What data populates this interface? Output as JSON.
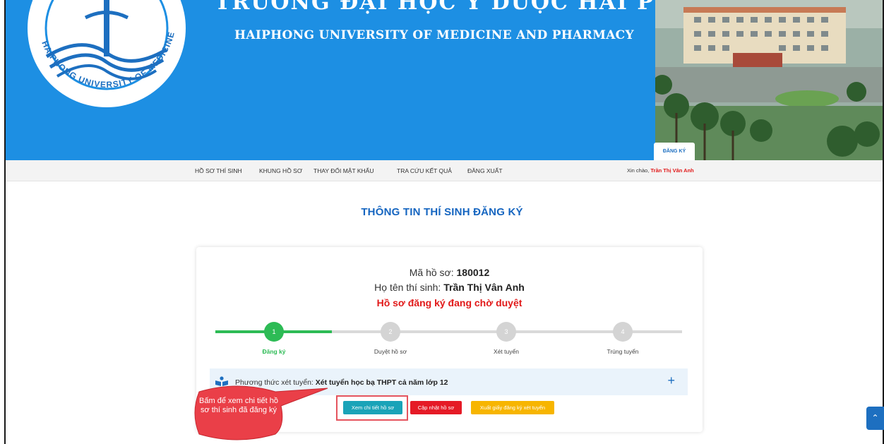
{
  "header": {
    "title_vn": "TRƯỜNG ĐẠI HỌC Y DƯỢC HẢI PHÒNG",
    "title_en": "HAIPHONG UNIVERSITY OF MEDICINE AND PHARMACY",
    "logo_text": "HAIPHONG UNIVERSITY OF MEDICINE AND PHARMACY",
    "register_tab": "ĐĂNG KÝ",
    "brand_color": "#1d8fe3"
  },
  "nav": {
    "items": [
      "HỒ SƠ THÍ SINH",
      "KHUNG HỒ SƠ",
      "THAY ĐỔI MẬT KHẨU",
      "TRA CỨU KẾT QUẢ",
      "ĐĂNG XUẤT"
    ],
    "greeting_prefix": "Xin chào, ",
    "user_name": "Trần Thị Vân Anh"
  },
  "page": {
    "title": "THÔNG TIN THÍ SINH ĐĂNG KÝ"
  },
  "profile": {
    "code_label": "Mã hồ sơ: ",
    "code_value": "180012",
    "name_label": "Họ tên thí sinh: ",
    "name_value": "Trần Thị Vân Anh",
    "status": "Hồ sơ đăng ký đang chờ duyệt",
    "status_color": "#e11919"
  },
  "stepper": {
    "active_step": 1,
    "steps": [
      {
        "number": "1",
        "label": "Đăng ký"
      },
      {
        "number": "2",
        "label": "Duyệt hồ sơ"
      },
      {
        "number": "3",
        "label": "Xét tuyển"
      },
      {
        "number": "4",
        "label": "Trúng tuyển"
      }
    ],
    "active_color": "#2dbb55"
  },
  "method": {
    "label": "Phương thức xét tuyển: ",
    "value": "Xét tuyển học bạ THPT cả năm lớp 12",
    "expand_icon": "plus-icon"
  },
  "actions": {
    "detail": "Xem chi tiết hồ sơ",
    "update": "Cập nhật hồ sơ",
    "export": "Xuất giấy đăng ký xét tuyển"
  },
  "callout": {
    "text": "Bấm để xem chi tiết hồ sơ thí sinh đã đăng ký"
  },
  "scroll_top_icon": "chevron-up-icon"
}
